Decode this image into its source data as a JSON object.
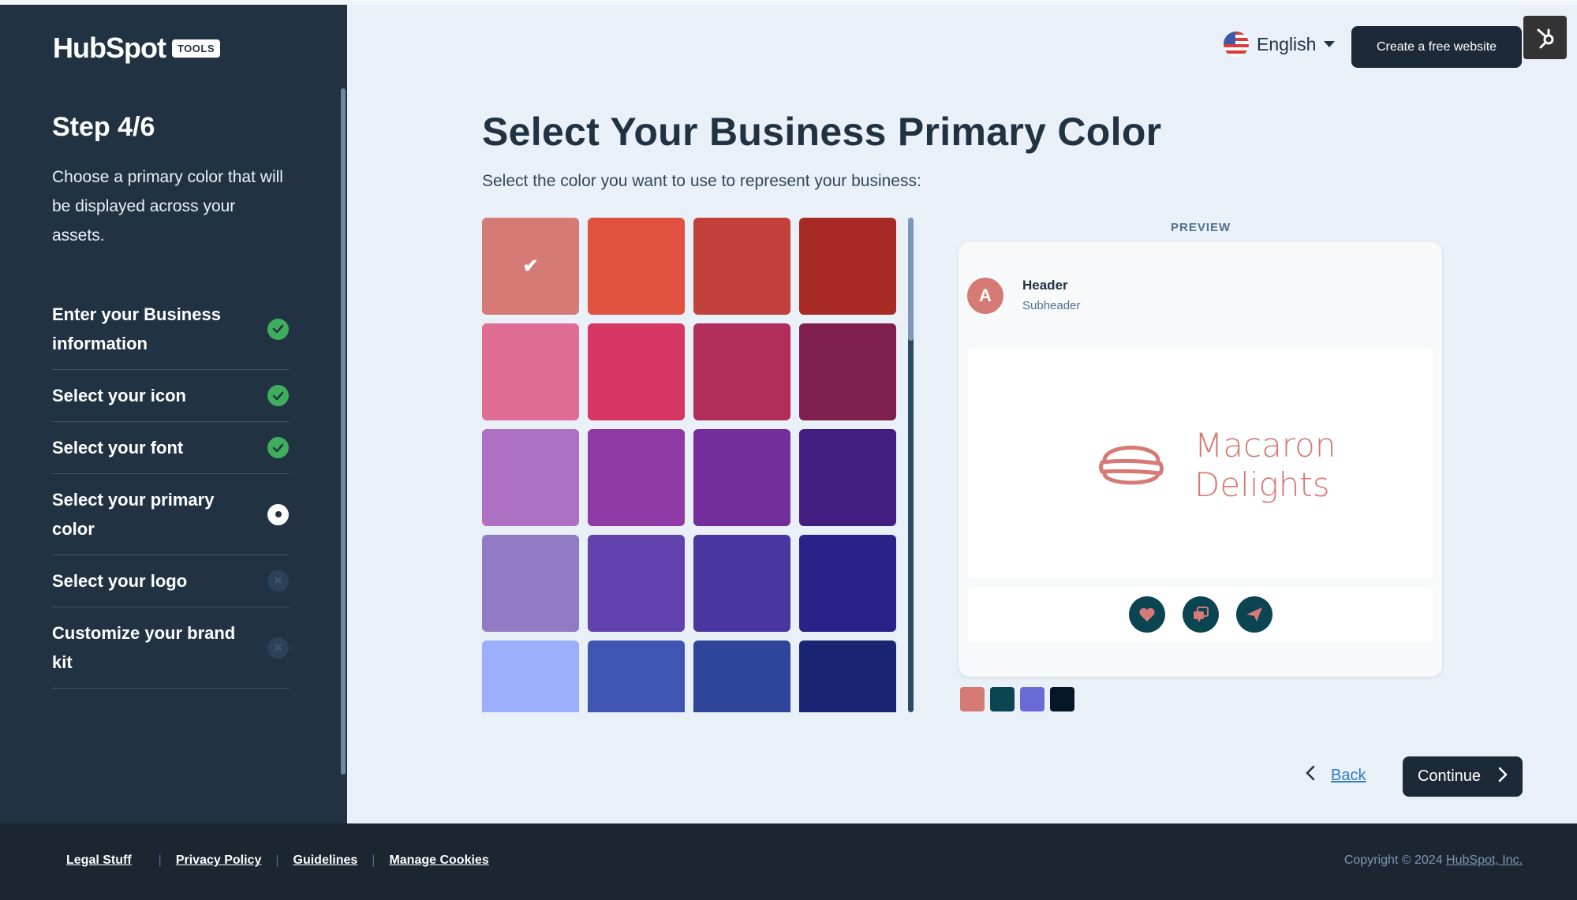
{
  "brand": {
    "logo_text": "HubSpot",
    "badge": "TOOLS"
  },
  "sidebar": {
    "step_title": "Step 4/6",
    "step_description": "Choose a primary color that will be displayed across your assets.",
    "steps": [
      {
        "label": "Enter your Business information",
        "status": "done"
      },
      {
        "label": "Select your icon",
        "status": "done"
      },
      {
        "label": "Select your font",
        "status": "done"
      },
      {
        "label": "Select your primary color",
        "status": "current"
      },
      {
        "label": "Select your logo",
        "status": "pending"
      },
      {
        "label": "Customize your brand kit",
        "status": "pending"
      }
    ]
  },
  "header": {
    "language": "English",
    "language_icon": "us-flag-icon",
    "cta_label": "Create a free website",
    "hubspot_badge_icon": "hubspot-sprocket-icon"
  },
  "main": {
    "title": "Select Your Business Primary Color",
    "subtitle": "Select the color you want to use to represent your business:",
    "selected_color": "#d57a74",
    "colors": [
      "#d57a74",
      "#e15140",
      "#c2403a",
      "#a82a24",
      "#e06d93",
      "#d73564",
      "#b12d5a",
      "#7e1f4e",
      "#ae70c3",
      "#8e39a6",
      "#742e9c",
      "#421e81",
      "#907bc4",
      "#6243ae",
      "#4b36a0",
      "#2a2289",
      "#9caffc",
      "#4055b1",
      "#2e4599",
      "#1a2674"
    ]
  },
  "preview": {
    "label": "PREVIEW",
    "avatar_letter": "A",
    "header": "Header",
    "subheader": "Subheader",
    "business_name_line1": "Macaron",
    "business_name_line2": "Delights",
    "business_icon": "macaron-icon",
    "actions": [
      "heart-icon",
      "chat-icon",
      "send-icon"
    ],
    "palette": [
      "#d57a74",
      "#0b4552",
      "#6a6bd6",
      "#051626"
    ]
  },
  "nav": {
    "back_label": "Back",
    "continue_label": "Continue"
  },
  "footer": {
    "links": [
      "Legal Stuff",
      "Privacy Policy",
      "Guidelines",
      "Manage Cookies"
    ],
    "copyright_prefix": "Copyright © 2024 ",
    "copyright_link": "HubSpot, Inc."
  }
}
